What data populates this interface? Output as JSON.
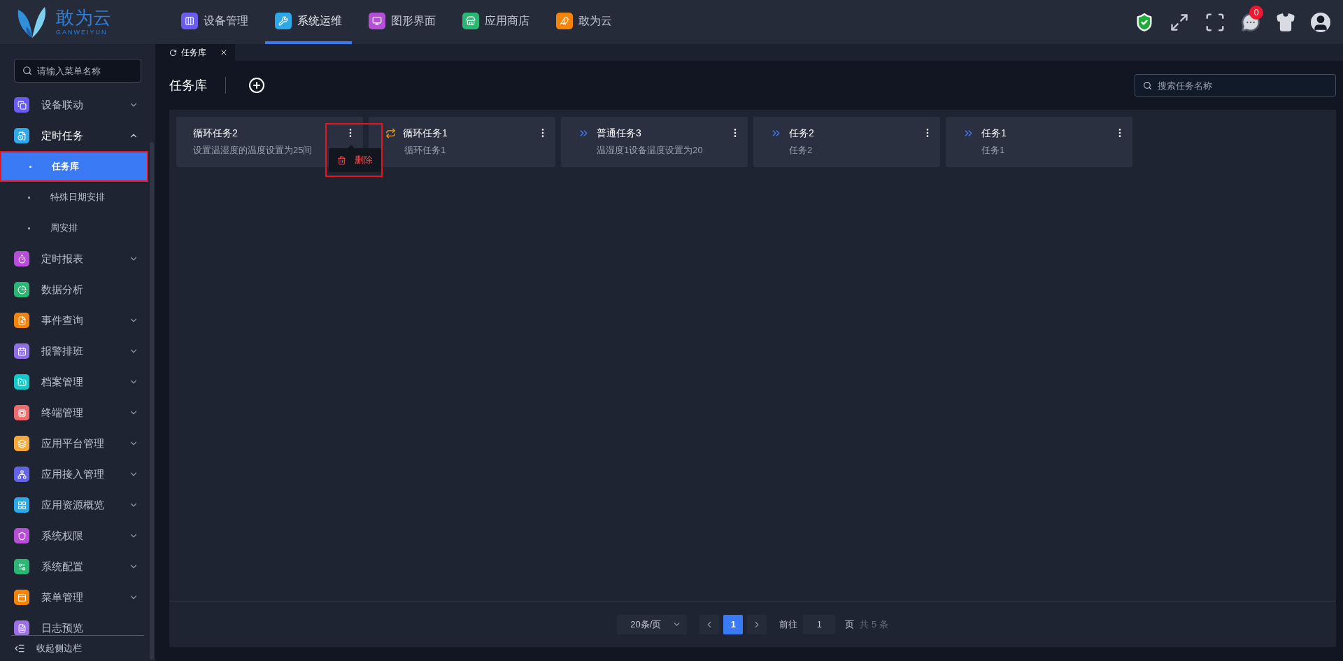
{
  "logo": {
    "name": "敢为云",
    "subtitle": "GANWEIYUN"
  },
  "nav": [
    {
      "label": "设备管理",
      "color": "#6a5cf0",
      "selected": false
    },
    {
      "label": "系统运维",
      "color": "#2ea8e6",
      "selected": true
    },
    {
      "label": "图形界面",
      "color": "#b44fd6",
      "selected": false
    },
    {
      "label": "应用商店",
      "color": "#2bb673",
      "selected": false
    },
    {
      "label": "敢为云",
      "color": "#f5830a",
      "selected": false
    }
  ],
  "toolbar": {
    "message_count": "0"
  },
  "sidebar": {
    "search": {
      "placeholder": "请输入菜单名称"
    },
    "items": [
      {
        "label": "设备联动",
        "color": "#6a5cf0",
        "kind": "group",
        "expanded": false
      },
      {
        "label": "定时任务",
        "color": "#2ea8e6",
        "kind": "group",
        "expanded": true,
        "children": [
          {
            "label": "任务库",
            "selected": true,
            "highlighted": true
          },
          {
            "label": "特殊日期安排",
            "selected": false,
            "highlighted": false
          },
          {
            "label": "周安排",
            "selected": false,
            "highlighted": false
          }
        ]
      },
      {
        "label": "定时报表",
        "color": "#b44fd6",
        "kind": "group",
        "expanded": false
      },
      {
        "label": "数据分析",
        "color": "#2bb673",
        "kind": "link"
      },
      {
        "label": "事件查询",
        "color": "#f5830a",
        "kind": "group",
        "expanded": false
      },
      {
        "label": "报警排班",
        "color": "#8e6fe8",
        "kind": "group",
        "expanded": false
      },
      {
        "label": "档案管理",
        "color": "#14c8c8",
        "kind": "group",
        "expanded": false
      },
      {
        "label": "终端管理",
        "color": "#f06a6a",
        "kind": "group",
        "expanded": false
      },
      {
        "label": "应用平台管理",
        "color": "#f5a93a",
        "kind": "group",
        "expanded": false
      },
      {
        "label": "应用接入管理",
        "color": "#6363e8",
        "kind": "group",
        "expanded": false
      },
      {
        "label": "应用资源概览",
        "color": "#2ea8e6",
        "kind": "group",
        "expanded": false
      },
      {
        "label": "系统权限",
        "color": "#b44fd6",
        "kind": "group",
        "expanded": false
      },
      {
        "label": "系统配置",
        "color": "#2bb673",
        "kind": "group",
        "expanded": false
      },
      {
        "label": "菜单管理",
        "color": "#f5830a",
        "kind": "group",
        "expanded": false
      },
      {
        "label": "日志预览",
        "color": "#9b6fe8",
        "kind": "link"
      }
    ],
    "collapse_label": "收起侧边栏"
  },
  "tabs": [
    {
      "label": "任务库",
      "selected": true
    }
  ],
  "page": {
    "title": "任务库",
    "search": {
      "placeholder": "搜索任务名称"
    }
  },
  "cards": [
    {
      "title": "循环任务2",
      "description": "设置温湿度的温度设置为25间",
      "kind": "plain",
      "menu_open": true,
      "highlighted": true,
      "menu_items": [
        "删除"
      ]
    },
    {
      "title": "循环任务1",
      "description": "循环任务1",
      "kind": "loop",
      "menu_open": false,
      "highlighted": false
    },
    {
      "title": "普通任务3",
      "description": "温湿度1设备温度设置为20",
      "kind": "normal",
      "menu_open": false,
      "highlighted": false
    },
    {
      "title": "任务2",
      "description": "任务2",
      "kind": "normal",
      "menu_open": false,
      "highlighted": false
    },
    {
      "title": "任务1",
      "description": "任务1",
      "kind": "normal",
      "menu_open": false,
      "highlighted": false
    }
  ],
  "pagination": {
    "page_size": "20条/页",
    "pages": [
      {
        "label": "1",
        "selected": true
      }
    ],
    "goto_label": "前往",
    "goto_value": "1",
    "page_unit": "页",
    "total": "共 5 条"
  }
}
